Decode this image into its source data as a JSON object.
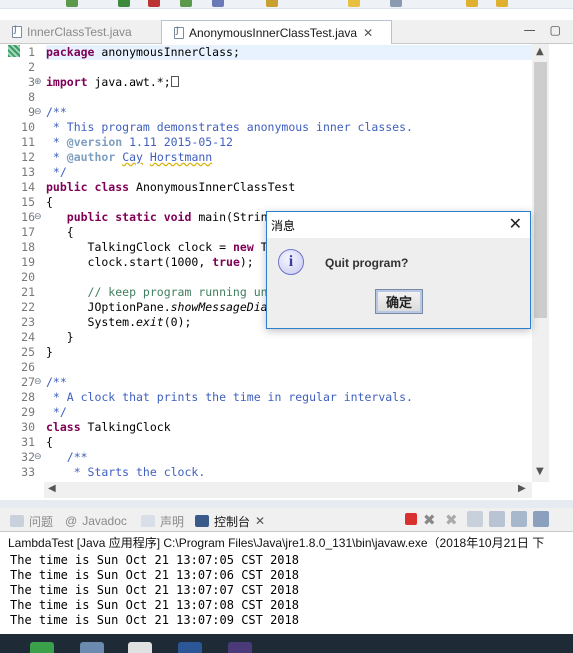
{
  "editor_tabs": [
    {
      "label": "InnerClassTest.java",
      "active": false
    },
    {
      "label": "AnonymousInnerClassTest.java",
      "active": true
    }
  ],
  "code_lines": [
    {
      "n": "1"
    },
    {
      "n": "2"
    },
    {
      "n": "3"
    },
    {
      "n": "8"
    },
    {
      "n": "9"
    },
    {
      "n": "10"
    },
    {
      "n": "11"
    },
    {
      "n": "12"
    },
    {
      "n": "13"
    },
    {
      "n": "14"
    },
    {
      "n": "15"
    },
    {
      "n": "16"
    },
    {
      "n": "17"
    },
    {
      "n": "18"
    },
    {
      "n": "19"
    },
    {
      "n": "20"
    },
    {
      "n": "21"
    },
    {
      "n": "22"
    },
    {
      "n": "23"
    },
    {
      "n": "24"
    },
    {
      "n": "25"
    },
    {
      "n": "26"
    },
    {
      "n": "27"
    },
    {
      "n": "28"
    },
    {
      "n": "29"
    },
    {
      "n": "30"
    },
    {
      "n": "31"
    },
    {
      "n": "32"
    },
    {
      "n": "33"
    }
  ],
  "code": {
    "l1_kw": "package",
    "l1_rest": " anonymousInnerClass;",
    "l3_kw": "import",
    "l3_rest": " java.awt.*;",
    "l9": "/**",
    "l10": " * This program demonstrates anonymous inner classes.",
    "l11_pre": " * ",
    "l11_tag": "@version",
    "l11_rest": " 1.11 2015-05-12",
    "l12_pre": " * ",
    "l12_tag": "@author",
    "l12_sp": " ",
    "l12_cay": "Cay",
    "l12_sp2": " ",
    "l12_name": "Horstmann",
    "l13": " */",
    "l14_kw": "public class",
    "l14_rest": " AnonymousInnerClassTest",
    "l15": "{",
    "l16_ind": "   ",
    "l16_kw": "public static void",
    "l16_rest": " main(Strin",
    "l17": "   {",
    "l18_ind": "      TalkingClock ",
    "l18_var": "clock",
    "l18_eq": " = ",
    "l18_kw": "new",
    "l18_rest": " T",
    "l19_ind": "      ",
    "l19_call": "clock.start(1000, ",
    "l19_kw": "true",
    "l19_end": ");",
    "l21": "      // keep program running un",
    "l22_ind": "      JOptionPane.",
    "l22_it": "showMessageDia",
    "l23_ind": "      System.",
    "l23_it": "exit",
    "l23_end": "(0);",
    "l24": "   }",
    "l25": "}",
    "l27": "/**",
    "l28": " * A clock that prints the time in regular intervals.",
    "l29": " */",
    "l30_kw": "class",
    "l30_rest": " TalkingClock",
    "l31": "{",
    "l32": "   /**",
    "l33": "    * Starts the clock."
  },
  "view_tabs": [
    {
      "label": "问题",
      "icon": "problems-icon"
    },
    {
      "label": "Javadoc",
      "icon": "javadoc-icon"
    },
    {
      "label": "声明",
      "icon": "declaration-icon"
    },
    {
      "label": "控制台",
      "icon": "console-icon",
      "active": true
    }
  ],
  "console": {
    "header": "LambdaTest [Java 应用程序] C:\\Program Files\\Java\\jre1.8.0_131\\bin\\javaw.exe（2018年10月21日 下",
    "lines": [
      "The time is Sun Oct 21 13:07:05 CST 2018",
      "The time is Sun Oct 21 13:07:06 CST 2018",
      "The time is Sun Oct 21 13:07:07 CST 2018",
      "The time is Sun Oct 21 13:07:08 CST 2018",
      "The time is Sun Oct 21 13:07:09 CST 2018"
    ]
  },
  "dialog": {
    "title": "消息",
    "message": "Quit program?",
    "ok_label": "确定",
    "info_glyph": "i"
  },
  "colors": {
    "keyword": "#7f0055",
    "comment": "#3f5fbf",
    "javadoc_tag": "#7f9fbf",
    "dialog_border": "#2c7fcf"
  }
}
